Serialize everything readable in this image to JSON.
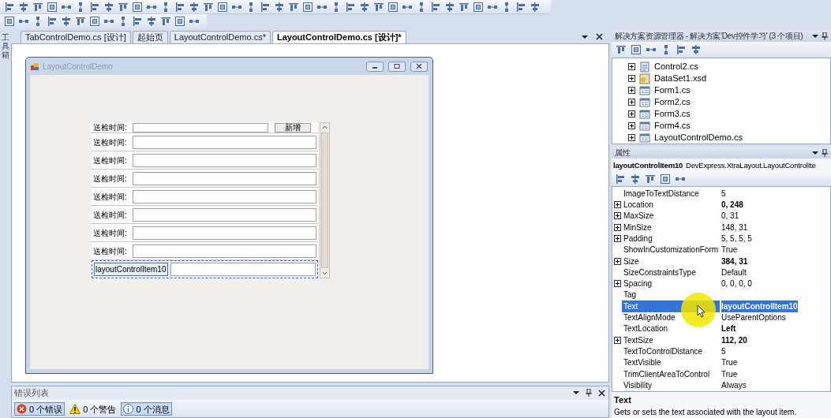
{
  "toolbox": {
    "label": "工具箱"
  },
  "tabs": [
    {
      "label": "TabControlDemo.cs [设计]",
      "selected": false
    },
    {
      "label": "起始页",
      "selected": false
    },
    {
      "label": "LayoutControlDemo.cs*",
      "selected": false
    },
    {
      "label": "LayoutControlDemo.cs [设计]*",
      "selected": true
    }
  ],
  "form": {
    "title": "LayoutControlDemo",
    "rows": [
      {
        "kind": "button_row",
        "label": "送检时间:",
        "button": "新增",
        "selected": false
      },
      {
        "kind": "field",
        "label": "送检时间:",
        "selected": false
      },
      {
        "kind": "field",
        "label": "送检时间:",
        "selected": false
      },
      {
        "kind": "field",
        "label": "送检时间:",
        "selected": false
      },
      {
        "kind": "field",
        "label": "送检时间:",
        "selected": false
      },
      {
        "kind": "field",
        "label": "送检时间:",
        "selected": false
      },
      {
        "kind": "field",
        "label": "送检时间:",
        "selected": false
      },
      {
        "kind": "field",
        "label": "送检时间:",
        "selected": false
      },
      {
        "kind": "field",
        "label": "layoutControlItem10",
        "selected": true
      }
    ]
  },
  "error_list": {
    "title": "错误列表",
    "buttons": [
      {
        "kind": "error",
        "label": "0 个错误",
        "selected": true
      },
      {
        "kind": "warning",
        "label": "0 个警告",
        "selected": false
      },
      {
        "kind": "info",
        "label": "0 个消息",
        "selected": true
      }
    ]
  },
  "solution_explorer": {
    "title": "解决方案资源管理器 - 解决方案'Dev控件学习' (3 个项目)",
    "items": [
      {
        "kind": "component",
        "label": "Control2.cs"
      },
      {
        "kind": "dataset",
        "label": "DataSet1.xsd"
      },
      {
        "kind": "form",
        "label": "Form1.cs"
      },
      {
        "kind": "form",
        "label": "Form2.cs"
      },
      {
        "kind": "form",
        "label": "Form3.cs"
      },
      {
        "kind": "form",
        "label": "Form4.cs"
      },
      {
        "kind": "form",
        "label": "LayoutControlDemo.cs"
      }
    ]
  },
  "properties": {
    "title": "属性",
    "object_name": "layoutControlItem10",
    "object_type": "DevExpress.XtraLayout.LayoutControlIte",
    "rows": [
      {
        "name": "ImageToTextDistance",
        "value": "5",
        "expandable": false,
        "bold": false,
        "selected": false
      },
      {
        "name": "Location",
        "value": "0, 248",
        "expandable": true,
        "bold": true,
        "selected": false
      },
      {
        "name": "MaxSize",
        "value": "0, 31",
        "expandable": true,
        "bold": false,
        "selected": false
      },
      {
        "name": "MinSize",
        "value": "148, 31",
        "expandable": true,
        "bold": false,
        "selected": false
      },
      {
        "name": "Padding",
        "value": "5, 5, 5, 5",
        "expandable": true,
        "bold": false,
        "selected": false
      },
      {
        "name": "ShowInCustomizationForm",
        "value": "True",
        "expandable": false,
        "bold": false,
        "selected": false
      },
      {
        "name": "Size",
        "value": "384, 31",
        "expandable": true,
        "bold": true,
        "selected": false
      },
      {
        "name": "SizeConstraintsType",
        "value": "Default",
        "expandable": false,
        "bold": false,
        "selected": false
      },
      {
        "name": "Spacing",
        "value": "0, 0, 0, 0",
        "expandable": true,
        "bold": false,
        "selected": false
      },
      {
        "name": "Tag",
        "expandable": false,
        "selected": false
      },
      {
        "name": "Text",
        "value": "layoutControlItem10",
        "expandable": false,
        "bold": true,
        "selected": true
      },
      {
        "name": "TextAlignMode",
        "value": "UseParentOptions",
        "expandable": false,
        "bold": false,
        "selected": false
      },
      {
        "name": "TextLocation",
        "value": "Left",
        "expandable": false,
        "bold": true,
        "selected": false
      },
      {
        "name": "TextSize",
        "value": "112, 20",
        "expandable": true,
        "bold": true,
        "selected": false
      },
      {
        "name": "TextToControlDistance",
        "value": "5",
        "expandable": false,
        "bold": false,
        "selected": false
      },
      {
        "name": "TextVisible",
        "value": "True",
        "expandable": false,
        "bold": false,
        "selected": false
      },
      {
        "name": "TrimClientAreaToControl",
        "value": "True",
        "expandable": false,
        "bold": false,
        "selected": false
      },
      {
        "name": "Visibility",
        "value": "Always",
        "expandable": false,
        "bold": false,
        "selected": false
      }
    ],
    "description_title": "Text",
    "description": "Gets or sets the text associated with the layout item."
  }
}
